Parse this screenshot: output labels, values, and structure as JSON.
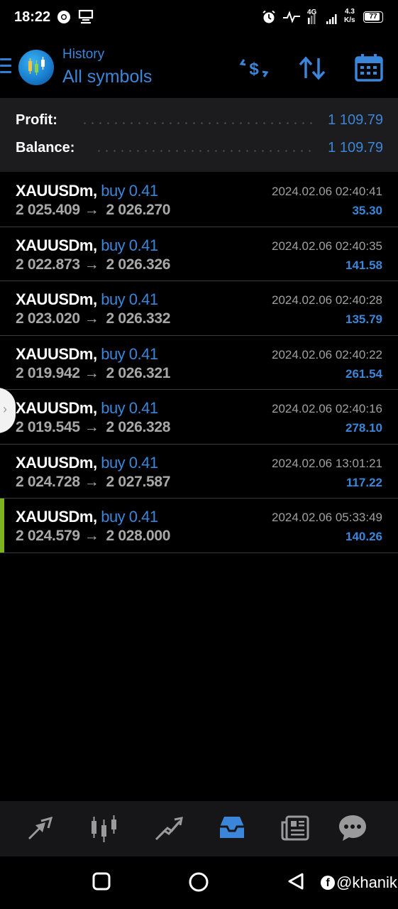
{
  "status_bar": {
    "time": "18:22",
    "network": "4G",
    "speed_value": "4.3",
    "speed_unit": "K/s",
    "battery": "77"
  },
  "header": {
    "subtitle": "History",
    "title": "All symbols"
  },
  "summary": {
    "profit_label": "Profit:",
    "profit_value": "1 109.79",
    "balance_label": "Balance:",
    "balance_value": "1 109.79"
  },
  "deals": [
    {
      "symbol": "XAUUSDm,",
      "type": "buy 0.41",
      "open": "2 025.409",
      "close": "2 026.270",
      "time": "2024.02.06 02:40:41",
      "profit": "35.30",
      "arrow": "→"
    },
    {
      "symbol": "XAUUSDm,",
      "type": "buy 0.41",
      "open": "2 022.873",
      "close": "2 026.326",
      "time": "2024.02.06 02:40:35",
      "profit": "141.58",
      "arrow": "→"
    },
    {
      "symbol": "XAUUSDm,",
      "type": "buy 0.41",
      "open": "2 023.020",
      "close": "2 026.332",
      "time": "2024.02.06 02:40:28",
      "profit": "135.79",
      "arrow": "→"
    },
    {
      "symbol": "XAUUSDm,",
      "type": "buy 0.41",
      "open": "2 019.942",
      "close": "2 026.321",
      "time": "2024.02.06 02:40:22",
      "profit": "261.54",
      "arrow": "→"
    },
    {
      "symbol": "XAUUSDm,",
      "type": "buy 0.41",
      "open": "2 019.545",
      "close": "2 026.328",
      "time": "2024.02.06 02:40:16",
      "profit": "278.10",
      "arrow": "→"
    },
    {
      "symbol": "XAUUSDm,",
      "type": "buy 0.41",
      "open": "2 024.728",
      "close": "2 027.587",
      "time": "2024.02.06 13:01:21",
      "profit": "117.22",
      "arrow": "→"
    },
    {
      "symbol": "XAUUSDm,",
      "type": "buy 0.41",
      "open": "2 024.579",
      "close": "2 028.000",
      "time": "2024.02.06 05:33:49",
      "profit": "140.26",
      "arrow": "→"
    }
  ],
  "watermark": {
    "fb_glyph": "f",
    "handle": "@khanik"
  },
  "colors": {
    "accent": "#3b86d8",
    "background": "#000000",
    "summary_bg": "#1c1c1e",
    "selected_marker": "#7fb21e"
  },
  "icons": {
    "header": [
      "menu-icon",
      "app-logo",
      "currency-filter-icon",
      "sort-icon",
      "calendar-icon"
    ],
    "toolbar": [
      "quotes-icon",
      "chart-icon",
      "trade-icon",
      "history-icon",
      "news-icon",
      "messages-icon"
    ],
    "nav": [
      "recents-icon",
      "home-icon",
      "back-icon"
    ]
  }
}
